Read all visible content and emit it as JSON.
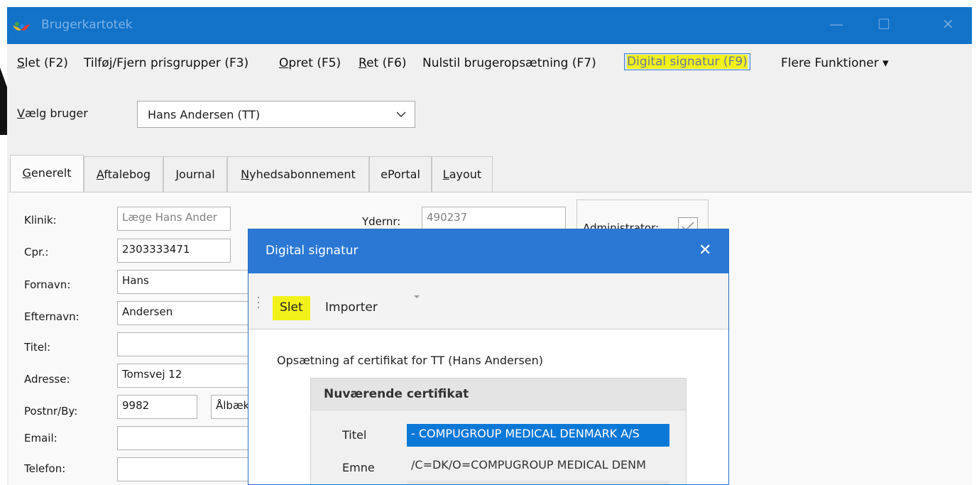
{
  "window": {
    "title": "Brugerkartotek",
    "minimize_glyph": "—",
    "maximize_glyph": "☐",
    "close_glyph": "✕"
  },
  "menu": {
    "items": [
      {
        "accel": "S",
        "rest": "let (F2)"
      },
      {
        "accel": "",
        "rest": "Tilføj/Fjern prisgrupper (F3)"
      },
      {
        "accel": "O",
        "rest": "pret (F5)"
      },
      {
        "accel": "R",
        "rest": "et (F6)"
      },
      {
        "accel": "",
        "rest": "Nulstil brugeropsætning (F7)"
      },
      {
        "accel": "",
        "rest": "Digital signatur (F9)"
      },
      {
        "accel": "",
        "rest": "Flere Funktioner",
        "caret": "▾"
      }
    ]
  },
  "user_select": {
    "label_accel": "V",
    "label_rest": "ælg bruger",
    "value": "Hans Andersen (TT)"
  },
  "tabs": [
    {
      "accel": "G",
      "rest": "enerelt"
    },
    {
      "accel": "A",
      "rest": "ftalebog"
    },
    {
      "accel": "J",
      "rest": "ournal"
    },
    {
      "accel": "N",
      "rest": "yhedsabonnement"
    },
    {
      "accel": "",
      "rest": "ePortal"
    },
    {
      "accel": "L",
      "rest": "ayout"
    }
  ],
  "form": {
    "klinik_label": "Klinik:",
    "klinik_value": "Læge Hans Ander",
    "cpr_label": "Cpr.:",
    "cpr_value": "2303333471",
    "fornavn_label": "Fornavn:",
    "fornavn_value": "Hans",
    "efternavn_label": "Efternavn:",
    "efternavn_value": "Andersen",
    "titel_label": "Titel:",
    "titel_value": "",
    "adresse_label": "Adresse:",
    "adresse_value": "Tomsvej 12",
    "postnr_label": "Postnr/By:",
    "postnr_value": "9982",
    "by_value": "Ålbæk",
    "email_label": "Email:",
    "email_value": "",
    "telefon_label": "Telefon:",
    "telefon_value": "",
    "ydernr_label": "Ydernr:",
    "ydernr_value": "490237",
    "admin_label": "Administrator:",
    "admin_checked": true
  },
  "dialog": {
    "title": "Digital signatur",
    "close_glyph": "✕",
    "toolbar": {
      "slet": "Slet",
      "importer": "Importer"
    },
    "description": "Opsætning af certifikat for TT (Hans Andersen)",
    "cert_header": "Nuværende certifikat",
    "titel_label": "Titel",
    "titel_value": " - COMPUGROUP MEDICAL DENMARK A/S",
    "emne_label": "Emne",
    "emne_value": "/C=DK/O=COMPUGROUP MEDICAL DENM"
  },
  "colors": {
    "titlebar": "#1272c8",
    "dialog_title": "#2b78d4",
    "highlight": "#f2f21a",
    "selection": "#0a78d7"
  }
}
